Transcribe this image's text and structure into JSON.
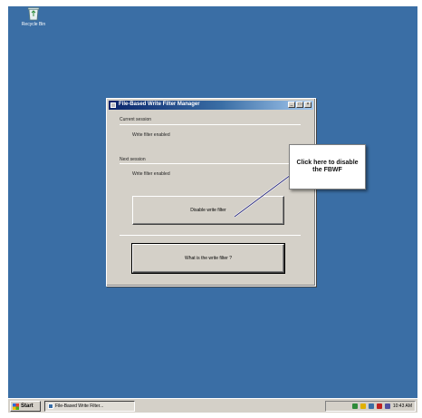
{
  "desktop": {
    "recycle_bin_label": "Recycle Bin"
  },
  "window": {
    "title": "File-Based Write Filter Manager",
    "minimize_glyph": "_",
    "maximize_glyph": "□",
    "close_glyph": "×",
    "current_session_label": "Current session",
    "current_session_status": "Write filter enabled",
    "next_session_label": "Next session",
    "next_session_status": "Write filter enabled",
    "disable_button_label": "Disable write filter",
    "whatis_button_label": "What is the write filter ?"
  },
  "callout": {
    "text": "Click here to disable the FBWF"
  },
  "taskbar": {
    "start_label": "Start",
    "task_label": "File-Based Write Filter...",
    "clock": "10:43 AM"
  },
  "colors": {
    "desktop": "#3a6ea5",
    "window_face": "#d4d0c8",
    "titlebar_start": "#0a246a",
    "titlebar_end": "#a6caf0"
  }
}
